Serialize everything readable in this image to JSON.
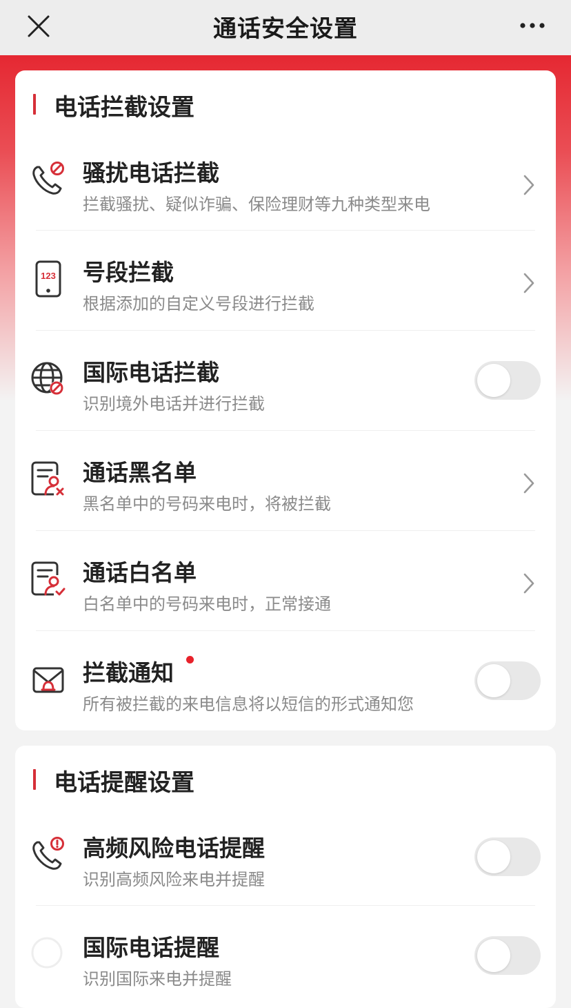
{
  "header": {
    "title": "通话安全设置"
  },
  "colors": {
    "accent": "#d62f38",
    "hero_top": "#e52832",
    "toggle_off": "#e8e8e8"
  },
  "sections": [
    {
      "title": "电话拦截设置",
      "items": [
        {
          "icon": "phone-block-icon",
          "title": "骚扰电话拦截",
          "subtitle": "拦截骚扰、疑似诈骗、保险理财等九种类型来电",
          "control": "chevron"
        },
        {
          "icon": "number-pad-icon",
          "icon_text": "123",
          "title": "号段拦截",
          "subtitle": "根据添加的自定义号段进行拦截",
          "control": "chevron"
        },
        {
          "icon": "globe-block-icon",
          "title": "国际电话拦截",
          "subtitle": "识别境外电话并进行拦截",
          "control": "toggle",
          "enabled": false
        },
        {
          "icon": "blacklist-icon",
          "title": "通话黑名单",
          "subtitle": "黑名单中的号码来电时，将被拦截",
          "control": "chevron"
        },
        {
          "icon": "whitelist-icon",
          "title": "通话白名单",
          "subtitle": "白名单中的号码来电时，正常接通",
          "control": "chevron"
        },
        {
          "icon": "mail-bell-icon",
          "title": "拦截通知",
          "subtitle": "所有被拦截的来电信息将以短信的形式通知您",
          "control": "toggle",
          "enabled": false,
          "badge_dot": true
        }
      ]
    },
    {
      "title": "电话提醒设置",
      "items": [
        {
          "icon": "phone-alert-icon",
          "title": "高频风险电话提醒",
          "subtitle": "识别高频风险来电并提醒",
          "control": "toggle",
          "enabled": false
        },
        {
          "icon": "globe-alert-icon",
          "title": "国际电话提醒",
          "subtitle": "识别国际来电并提醒",
          "control": "toggle",
          "enabled": false
        }
      ]
    }
  ]
}
